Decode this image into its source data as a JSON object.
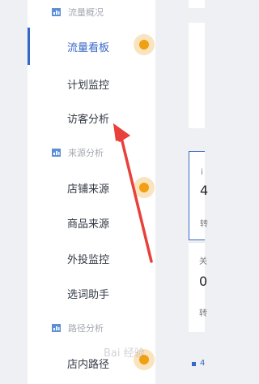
{
  "sidebar": {
    "groups": [
      {
        "label": "流量概况",
        "icon": "chart-icon"
      },
      {
        "label": "来源分析",
        "icon": "chart-icon"
      },
      {
        "label": "路径分析",
        "icon": "chart-icon"
      }
    ],
    "items": [
      {
        "label": "流量看板",
        "active": true
      },
      {
        "label": "计划监控"
      },
      {
        "label": "访客分析"
      },
      {
        "label": "店铺来源"
      },
      {
        "label": "商品来源"
      },
      {
        "label": "外投监控"
      },
      {
        "label": "选词助手"
      },
      {
        "label": "店内路径"
      }
    ]
  },
  "panel": {
    "frag1": "i",
    "frag2": "4",
    "frag3": "转",
    "frag4": "关",
    "frag5": "0",
    "frag6": "转",
    "frag7": "4"
  },
  "watermark": "Bai 经验",
  "colors": {
    "accent": "#3768c6",
    "dot": "#f0a010",
    "arrow": "#e8403a"
  }
}
